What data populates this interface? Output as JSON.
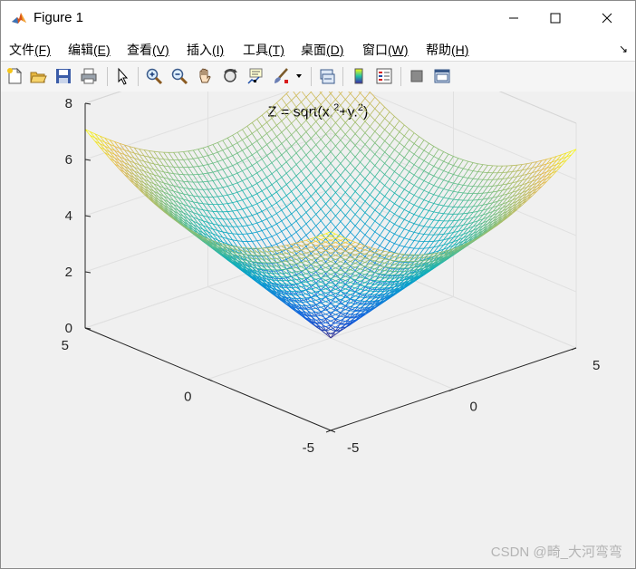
{
  "window": {
    "title": "Figure 1"
  },
  "menu": [
    {
      "label": "文件",
      "key": "(F)"
    },
    {
      "label": "编辑",
      "key": "(E)"
    },
    {
      "label": "查看",
      "key": "(V)"
    },
    {
      "label": "插入",
      "key": "(I)"
    },
    {
      "label": "工具",
      "key": "(T)"
    },
    {
      "label": "桌面",
      "key": "(D)"
    },
    {
      "label": "窗口",
      "key": "(W)"
    },
    {
      "label": "帮助",
      "key": "(H)"
    }
  ],
  "toolbar": [
    "new-figure-icon",
    "open-icon",
    "save-icon",
    "print-icon",
    "pointer-icon",
    "zoom-in-icon",
    "zoom-out-icon",
    "pan-icon",
    "rotate-3d-icon",
    "data-cursor-icon",
    "brush-icon",
    "link-plot-icon",
    "colorbar-icon",
    "legend-icon",
    "hide-plot-tools-icon",
    "show-plot-tools-icon"
  ],
  "chart_data": {
    "type": "surface-mesh",
    "title_parts": {
      "base": "Z = sqrt(x.",
      "sup1": "2",
      "mid": "+y.",
      "sup2": "2",
      "end": ")"
    },
    "function": "sqrt(x.^2+y.^2)",
    "x_range": [
      -5,
      5
    ],
    "y_range": [
      -5,
      5
    ],
    "z_range": [
      0,
      8
    ],
    "x_ticks": [
      "-5",
      "0",
      "5"
    ],
    "y_ticks": [
      "-5",
      "0",
      "5"
    ],
    "z_ticks": [
      "0",
      "2",
      "4",
      "6",
      "8"
    ],
    "colormap": "parula",
    "grid": true
  },
  "watermark": "CSDN @畸_大河弯弯"
}
